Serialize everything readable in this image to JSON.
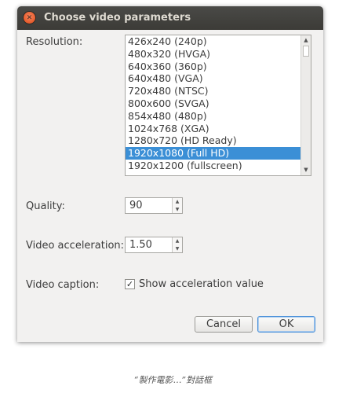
{
  "window": {
    "title": "Choose video parameters",
    "close_icon": "close-icon"
  },
  "resolution": {
    "label": "Resolution:",
    "selected": "1920x1080 (Full HD)",
    "options": [
      "426x240 (240p)",
      "480x320 (HVGA)",
      "640x360 (360p)",
      "640x480 (VGA)",
      "720x480 (NTSC)",
      "800x600 (SVGA)",
      "854x480 (480p)",
      "1024x768 (XGA)",
      "1280x720 (HD Ready)",
      "1920x1080 (Full HD)",
      "1920x1200 (fullscreen)"
    ]
  },
  "quality": {
    "label": "Quality:",
    "value": "90"
  },
  "acceleration": {
    "label": "Video acceleration:",
    "value": "1.50"
  },
  "caption": {
    "label": "Video caption:",
    "checkbox_label": "Show acceleration value",
    "checked": true,
    "check_glyph": "✓"
  },
  "buttons": {
    "cancel": "Cancel",
    "ok": "OK"
  },
  "figure_caption": "“製作電影…”對話框",
  "colors": {
    "titlebar": "#3c3b37",
    "selection": "#3b8fd6",
    "close_button": "#df4a16"
  }
}
